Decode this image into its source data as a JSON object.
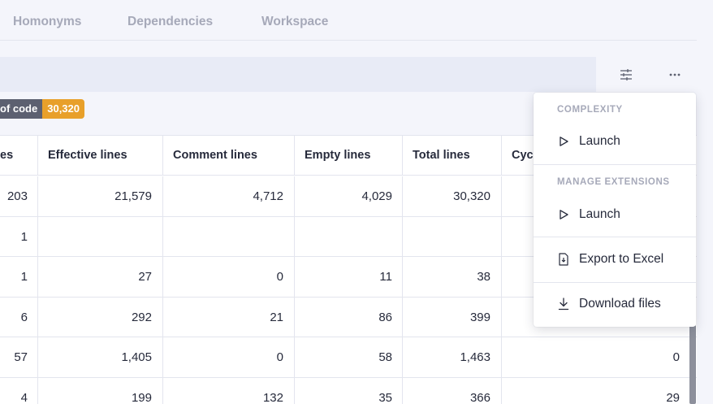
{
  "tabs": [
    {
      "label": "Homonyms"
    },
    {
      "label": "Dependencies"
    },
    {
      "label": "Workspace"
    }
  ],
  "toolbar": {
    "filter_icon": "sliders-icon",
    "more_icon": "more-horizontal-icon"
  },
  "badge": {
    "label": "of code",
    "value": "30,320",
    "value_color": "#e8a02a"
  },
  "table": {
    "columns": [
      "es",
      "Effective lines",
      "Comment lines",
      "Empty lines",
      "Total lines",
      "Cyc"
    ],
    "rows": [
      [
        "203",
        "21,579",
        "4,712",
        "4,029",
        "30,320",
        ""
      ],
      [
        "1",
        "",
        "",
        "",
        "",
        ""
      ],
      [
        "1",
        "27",
        "0",
        "11",
        "38",
        ""
      ],
      [
        "6",
        "292",
        "21",
        "86",
        "399",
        ""
      ],
      [
        "57",
        "1,405",
        "0",
        "58",
        "1,463",
        "0"
      ],
      [
        "4",
        "199",
        "132",
        "35",
        "366",
        "29"
      ]
    ]
  },
  "menu": {
    "sections": [
      {
        "title": "COMPLEXITY",
        "items": [
          {
            "label": "Launch",
            "icon": "play-icon"
          }
        ]
      },
      {
        "title": "MANAGE EXTENSIONS",
        "items": [
          {
            "label": "Launch",
            "icon": "play-icon"
          }
        ]
      }
    ],
    "extra_items": [
      {
        "label": "Export to Excel",
        "icon": "file-export-icon"
      },
      {
        "label": "Download files",
        "icon": "download-icon"
      }
    ]
  }
}
